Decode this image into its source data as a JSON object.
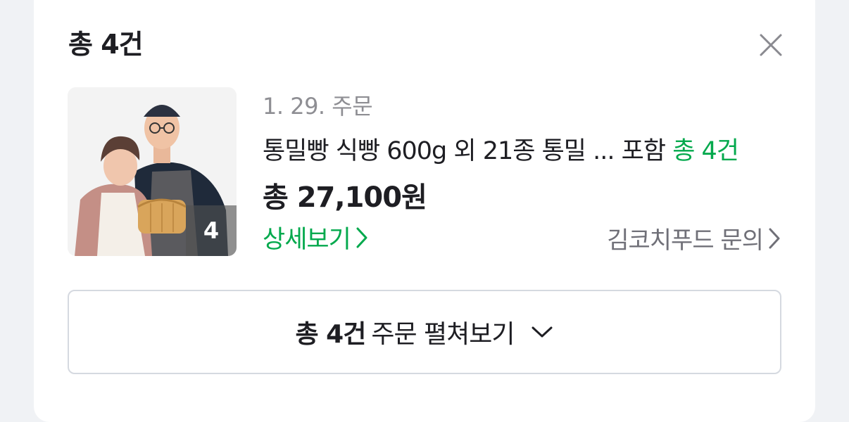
{
  "header": {
    "title": "총 4건"
  },
  "icons": {
    "close": "close-icon",
    "chevron_right": "chevron-right-icon",
    "chevron_down": "chevron-down-icon"
  },
  "order": {
    "date_label": "1. 29. 주문",
    "product_summary": "통밀빵 식빵 600g 외 21종 통밀 ...",
    "product_suffix": "포함",
    "product_count": "총 4건",
    "total_price": "총 27,100원",
    "thumbnail_count": "4",
    "detail_label": "상세보기",
    "seller_inquiry_label": "김코치푸드 문의"
  },
  "expand": {
    "count_label": "총 4건",
    "action_label": "주문 펼쳐보기"
  },
  "colors": {
    "accent_green": "#03a94d",
    "text_primary": "#1e1e23",
    "text_secondary": "#8e8e93",
    "border": "#d5d9e0"
  }
}
